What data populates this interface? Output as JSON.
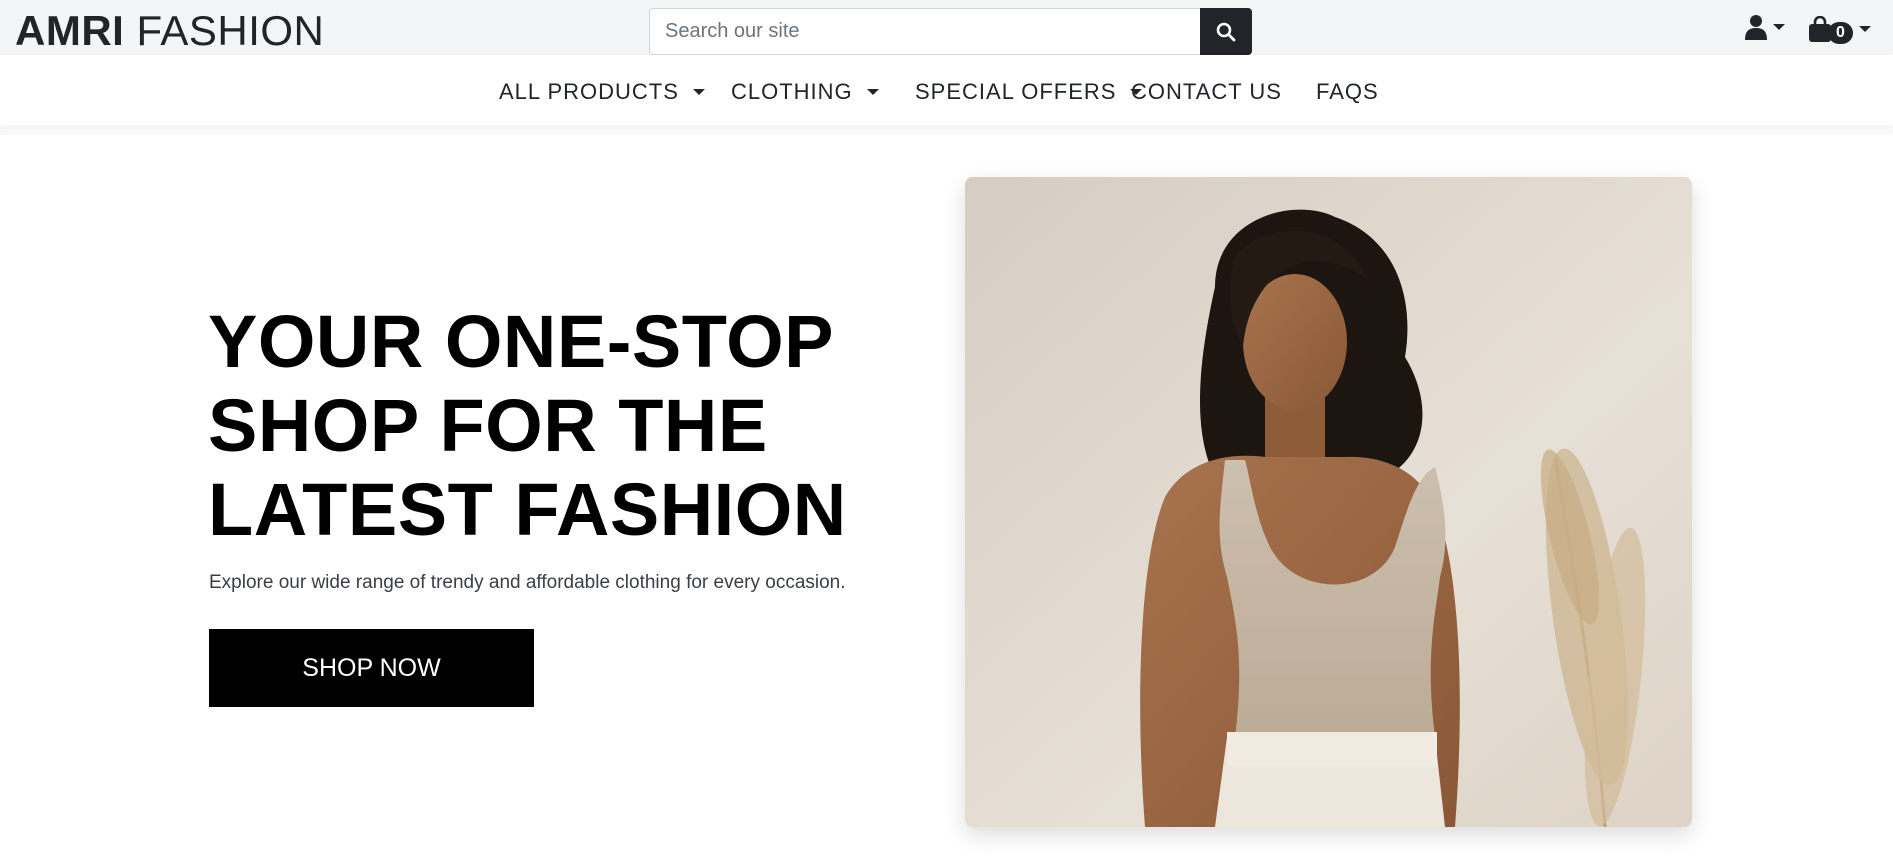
{
  "brand": {
    "part1": "AMRI",
    "part2": "FASHION"
  },
  "search": {
    "placeholder": "Search our site",
    "value": ""
  },
  "account": {
    "icon": "user-icon"
  },
  "cart": {
    "icon": "shopping-bag-icon",
    "count": "0"
  },
  "nav": {
    "items": [
      {
        "label": "ALL PRODUCTS",
        "has_dropdown": true
      },
      {
        "label": "CLOTHING",
        "has_dropdown": true
      },
      {
        "label": "SPECIAL OFFERS",
        "has_dropdown": true
      },
      {
        "label": "CONTACT US",
        "has_dropdown": false
      },
      {
        "label": "FAQS",
        "has_dropdown": false
      }
    ]
  },
  "hero": {
    "title_lines": [
      "YOUR ONE-STOP",
      "SHOP FOR THE",
      "LATEST FASHION"
    ],
    "subtitle": "Explore our wide range of trendy and affordable clothing for every occasion.",
    "cta_label": "SHOP NOW"
  },
  "colors": {
    "dark": "#212529",
    "black": "#000000",
    "topbar_bg": "#f4f5f7"
  }
}
